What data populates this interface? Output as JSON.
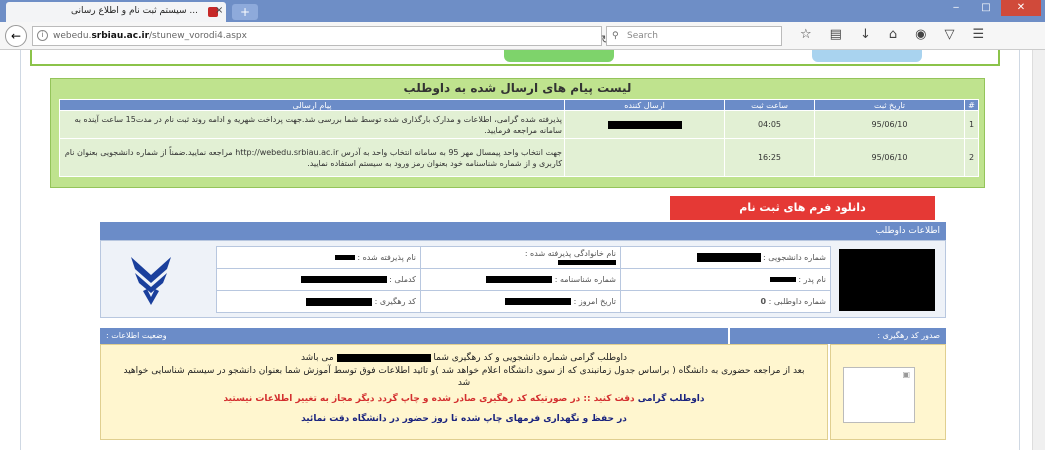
{
  "browser": {
    "tab_title": "... سیستم ثبت نام و اطلاع رسانی",
    "tab_close": "×",
    "new_tab": "+",
    "url_prefix": "webedu.",
    "url_domain": "srbiau.ac.ir",
    "url_path": "/stunew_vorodi4.aspx",
    "search_placeholder": "Search",
    "window_min": "‒",
    "window_max": "□",
    "window_close": "✕"
  },
  "messages": {
    "title": "لیست پیام های ارسال شده به داوطلب",
    "headers": [
      "#",
      "تاریخ ثبت",
      "ساعت ثبت",
      "ارسال کننده",
      "پیام ارسالی"
    ],
    "rows": [
      {
        "num": "1",
        "date": "95/06/10",
        "time": "04:05",
        "text": "پذیرفته شده گرامی، اطلاعات و مدارک بارگذاری شده توسط شما بررسی شد.جهت پرداخت شهریه و ادامه روند ثبت نام در مدت15 ساعت آینده به سامانه مراجعه فرمایید."
      },
      {
        "num": "2",
        "date": "95/06/10",
        "time": "16:25",
        "text": "جهت انتخاب واحد پیمسال مهر 95 به سامانه انتخاب واحد به آدرس http://webedu.srbiau.ac.ir مراجعه نمایید.ضمناً از شماره دانشجویی بعنوان نام کاربری و از شماره شناسنامه خود بعنوان رمز ورود به سیستم استفاده نمایید."
      }
    ]
  },
  "download_button": "دانلود فرم های ثبت نام",
  "applicant": {
    "header": "اطلاعات داوطلب",
    "student_no_label": "شماره دانشجویی :",
    "family_label": "نام خانوادگی پذیرفته شده :",
    "accepted_name_label": "نام پذیرفته شده :",
    "father_label": "نام پدر :",
    "id_no_label": "شماره شناسنامه :",
    "national_code_label": "کدملی :",
    "applicant_no_label": "شماره داوطلبی :",
    "applicant_no_value": "0",
    "today_label": "تاریخ امروز :",
    "tracking_label": "کد رهگیری :"
  },
  "status": {
    "left_title": "وضعیت اطلاعات :",
    "right_title": "صدور کد رهگیری :",
    "line1_a": "داوطلب گرامی شماره دانشجویی و کد رهگیری شما",
    "line1_b": "می باشد",
    "line2": "بعد از مراجعه حضوری به دانشگاه ( براساس جدول زمانبندی که از سوی دانشگاه اعلام خواهد شد )و تائید اطلاعات فوق توسط آموزش شما بعنوان دانشجو در سیستم شناسایی خواهید شد",
    "line3_a": "داوطلب گرامی",
    "line3_b": "دقت کنید :: در صورتیکه کد رهگیری صادر شده و چاپ گردد دیگر مجاز به تغییر اطلاعات نیستید",
    "line4": "در حفظ و نگهداری فرمهای چاپ شده تا روز حضور در دانشگاه دقت نمائید"
  }
}
